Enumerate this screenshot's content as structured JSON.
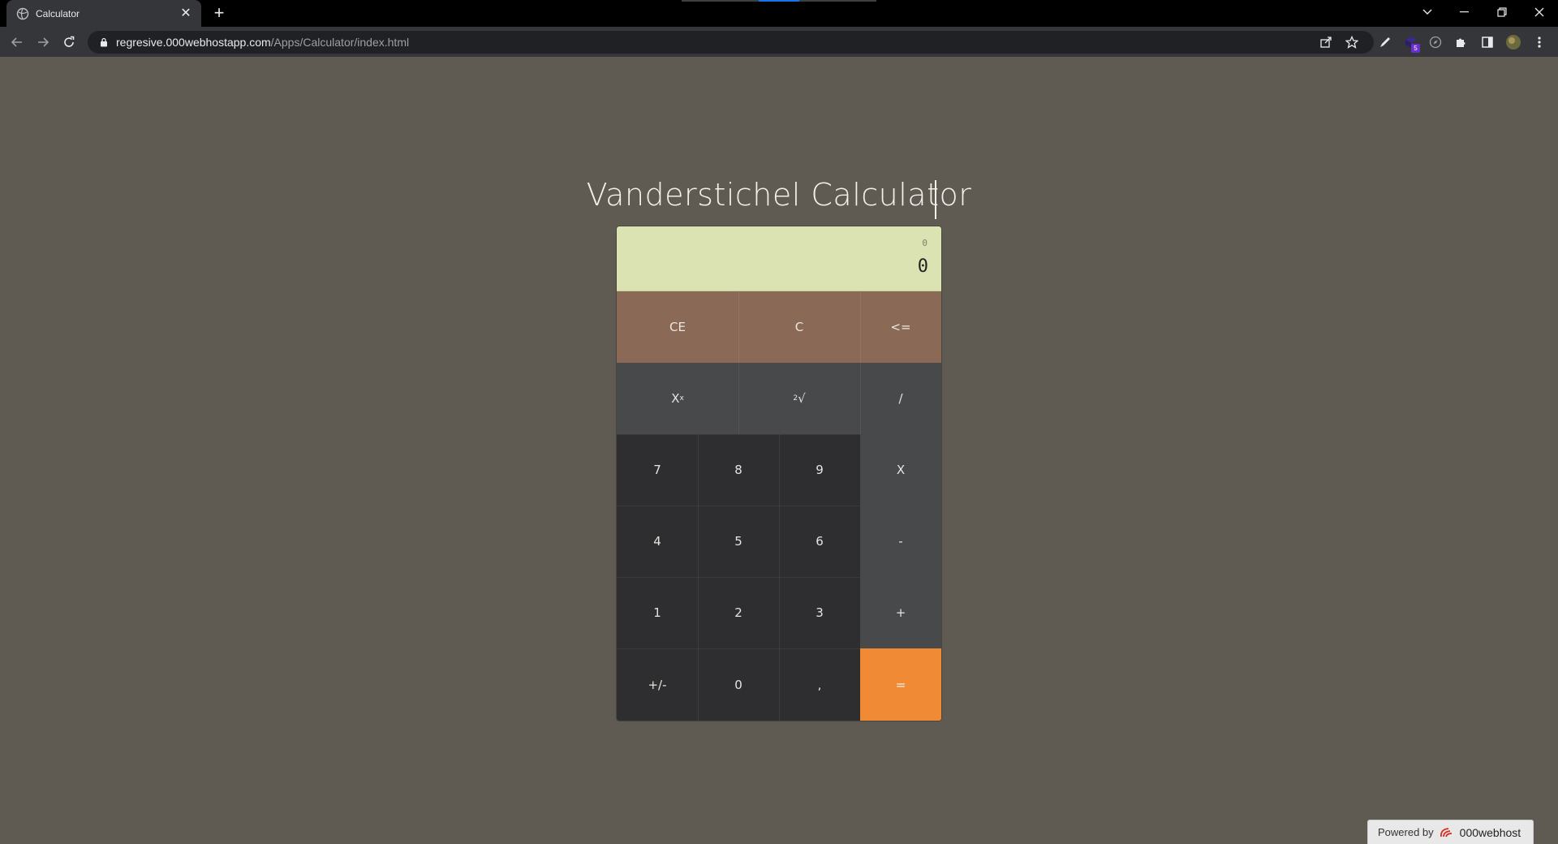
{
  "browser": {
    "tab_title": "Calculator",
    "url_host": "regresive.000webhostapp.com",
    "url_path": "/Apps/Calculator/index.html",
    "extension_badge": "5"
  },
  "page": {
    "title": "Vanderstichel Calculator"
  },
  "calculator": {
    "previous_value": "0",
    "current_value": "0",
    "keys": {
      "ce": "CE",
      "c": "C",
      "backspace": "<=",
      "power_base": "X",
      "power_exp": "x",
      "sqrt_index": "2",
      "sqrt_symbol": "√",
      "divide": "/",
      "seven": "7",
      "eight": "8",
      "nine": "9",
      "multiply": "X",
      "four": "4",
      "five": "5",
      "six": "6",
      "minus": "-",
      "one": "1",
      "two": "2",
      "three": "3",
      "plus": "+",
      "negate": "+/-",
      "zero": "0",
      "decimal": ",",
      "equals": "="
    }
  },
  "footer": {
    "powered_label": "Powered by",
    "brand": "000webhost"
  },
  "colors": {
    "page_bg": "#5f5a52",
    "display_bg": "#dbe3b2",
    "top_row": "#8b6957",
    "function_keys": "#48494b",
    "number_keys": "#2e2e30",
    "equals": "#f08a34"
  }
}
